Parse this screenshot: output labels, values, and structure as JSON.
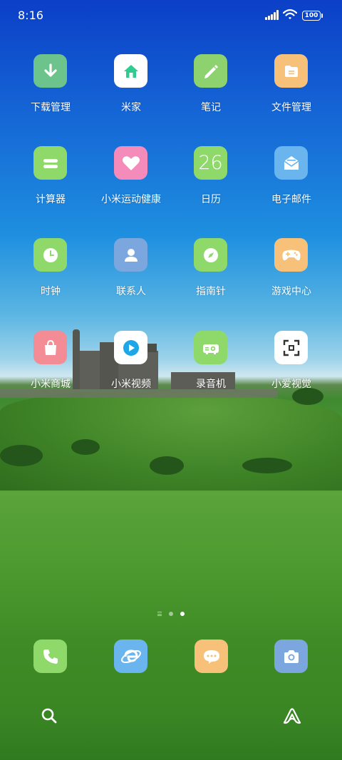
{
  "status_bar": {
    "time": "8:16",
    "battery": "100"
  },
  "apps": [
    {
      "label": "下载管理",
      "icon": "download-icon",
      "color": "#6cc38b"
    },
    {
      "label": "米家",
      "icon": "home-icon",
      "color": "#ffffff"
    },
    {
      "label": "笔记",
      "icon": "pencil-icon",
      "color": "#8ed16f"
    },
    {
      "label": "文件管理",
      "icon": "folder-icon",
      "color": "#f8c17a"
    },
    {
      "label": "计算器",
      "icon": "calculator-icon",
      "color": "#8fd96a"
    },
    {
      "label": "小米运动健康",
      "icon": "heart-icon",
      "color": "#f48bbb"
    },
    {
      "label": "日历",
      "icon_text": "26",
      "icon": "calendar-icon",
      "color": "#8fd96a"
    },
    {
      "label": "电子邮件",
      "icon": "mail-icon",
      "color": "#6ab5ee"
    },
    {
      "label": "时钟",
      "icon": "clock-icon",
      "color": "#8fd96a"
    },
    {
      "label": "联系人",
      "icon": "contact-icon",
      "color": "#7ba6de"
    },
    {
      "label": "指南针",
      "icon": "compass-icon",
      "color": "#8fd96a"
    },
    {
      "label": "游戏中心",
      "icon": "gamepad-icon",
      "color": "#f8c17a"
    },
    {
      "label": "小米商城",
      "icon": "shopping-bag-icon",
      "color": "#f48c96"
    },
    {
      "label": "小米视频",
      "icon": "play-icon",
      "color": "#ffffff"
    },
    {
      "label": "录音机",
      "icon": "recorder-icon",
      "color": "#8fd96a"
    },
    {
      "label": "小爱视觉",
      "icon": "scan-icon",
      "color": "#ffffff"
    }
  ],
  "pager": {
    "pages": 2,
    "current": 2
  },
  "dock": [
    {
      "icon": "phone-icon",
      "color": "#8fd96a"
    },
    {
      "icon": "browser-icon",
      "color": "#6ab5ee"
    },
    {
      "icon": "messages-icon",
      "color": "#f8c17a"
    },
    {
      "icon": "camera-icon",
      "color": "#7ba6de"
    }
  ],
  "bottom_bar": [
    {
      "icon": "search-icon"
    },
    {
      "icon": "assistant-icon"
    }
  ]
}
